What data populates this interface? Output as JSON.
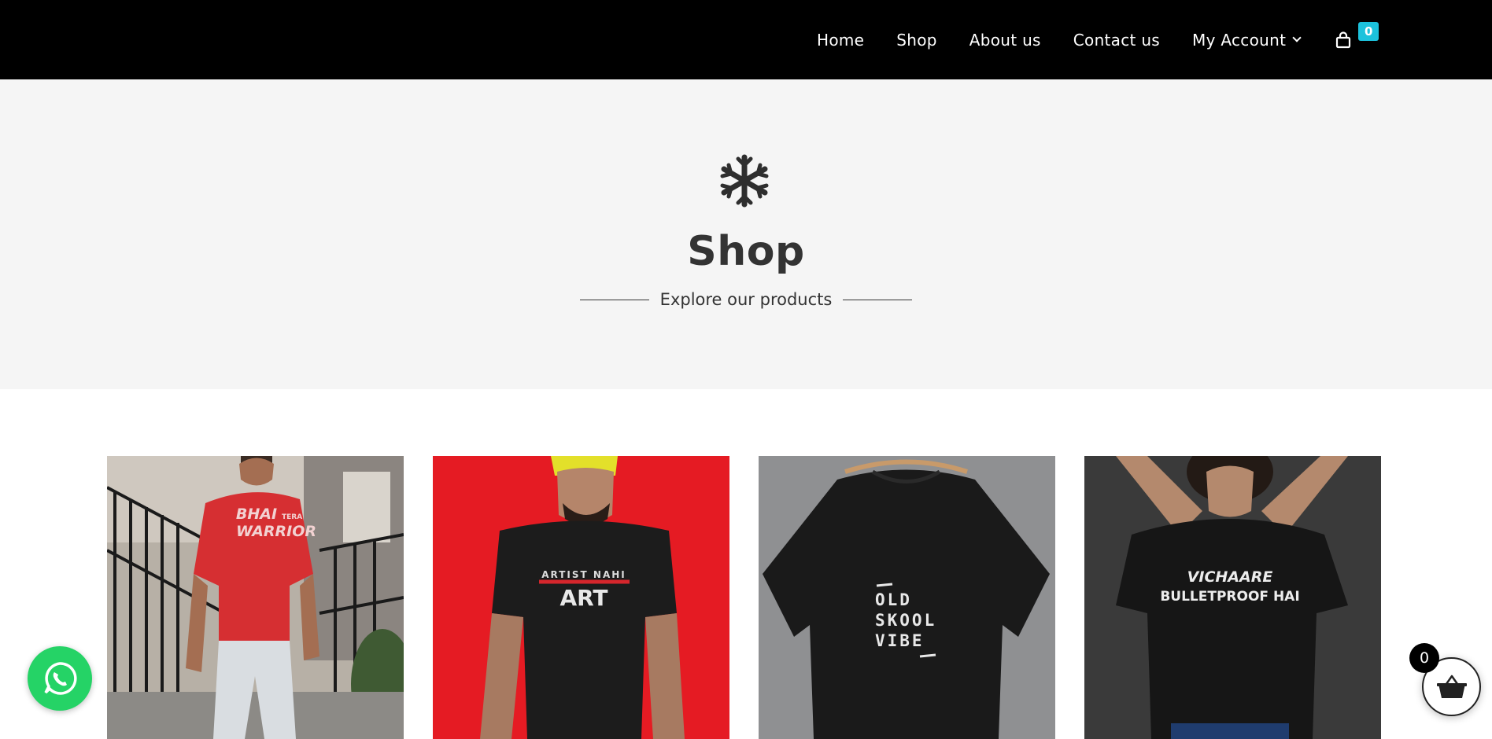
{
  "nav": {
    "items": [
      {
        "label": "Home"
      },
      {
        "label": "Shop"
      },
      {
        "label": "About us"
      },
      {
        "label": "Contact us"
      },
      {
        "label": "My Account"
      }
    ],
    "cart_count": "0"
  },
  "hero": {
    "title": "Shop",
    "subtitle": "Explore our products"
  },
  "products": [
    {
      "print_line1": "BHAI",
      "print_small": "TERA",
      "print_line2": "WARRIOR"
    },
    {
      "print_line1": "ARTIST NAHI",
      "print_line2": "ART"
    },
    {
      "print_line1": "OLD",
      "print_line2": "SKOOL",
      "print_line3": "VIBE"
    },
    {
      "print_line1": "VICHAARE",
      "print_line2": "BULLETPROOF HAI"
    }
  ],
  "floating": {
    "basket_count": "0"
  },
  "colors": {
    "header_bg": "#000000",
    "hero_bg": "#f5f5f5",
    "badge_accent": "#1cc2dc",
    "whatsapp_green": "#25d366"
  },
  "icons": [
    "chevron-down-icon",
    "shopping-bag-icon",
    "snowflake-icon",
    "whatsapp-icon",
    "basket-icon"
  ]
}
